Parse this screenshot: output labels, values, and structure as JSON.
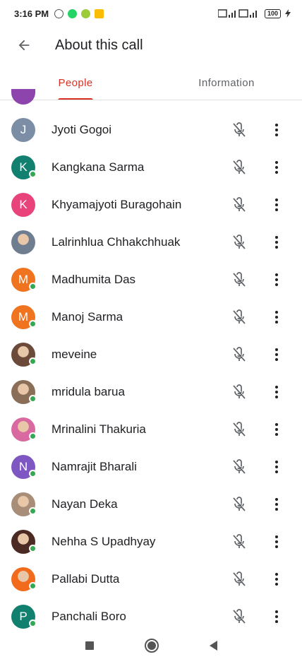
{
  "status_bar": {
    "time": "3:16 PM",
    "battery": "100"
  },
  "app_bar": {
    "title": "About this call"
  },
  "tabs": [
    {
      "label": "People",
      "active": true
    },
    {
      "label": "Information",
      "active": false
    }
  ],
  "colors": {
    "accent": "#d93025",
    "online": "#34a853",
    "peek_avatar": "#8e44ad"
  },
  "people": [
    {
      "name": "Jyoti Gogoi",
      "initial": "J",
      "avatar_color": "#7b8ea6",
      "photo": false,
      "online": false,
      "muted": true
    },
    {
      "name": "Kangkana Sarma",
      "initial": "K",
      "avatar_color": "#12806f",
      "photo": false,
      "online": true,
      "muted": true
    },
    {
      "name": "Khyamajyoti Buragohain",
      "initial": "K",
      "avatar_color": "#e8437a",
      "photo": false,
      "online": false,
      "muted": true
    },
    {
      "name": "Lalrinhlua Chhakchhuak",
      "initial": "",
      "avatar_color": "#6f7d90",
      "photo": true,
      "online": false,
      "muted": true
    },
    {
      "name": "Madhumita Das",
      "initial": "M",
      "avatar_color": "#f0731f",
      "photo": false,
      "online": true,
      "muted": true
    },
    {
      "name": "Manoj Sarma",
      "initial": "M",
      "avatar_color": "#f0731f",
      "photo": false,
      "online": true,
      "muted": true
    },
    {
      "name": "meveine",
      "initial": "",
      "avatar_color": "#6b4a3a",
      "photo": true,
      "online": true,
      "muted": true
    },
    {
      "name": "mridula barua",
      "initial": "",
      "avatar_color": "#8a6e58",
      "photo": true,
      "online": true,
      "muted": true
    },
    {
      "name": "Mrinalini Thakuria",
      "initial": "",
      "avatar_color": "#d96aa1",
      "photo": true,
      "online": true,
      "muted": true
    },
    {
      "name": "Namrajit Bharali",
      "initial": "N",
      "avatar_color": "#7e57c2",
      "photo": false,
      "online": true,
      "muted": true
    },
    {
      "name": "Nayan Deka",
      "initial": "",
      "avatar_color": "#a88d78",
      "photo": true,
      "online": true,
      "muted": true
    },
    {
      "name": "Nehha S Upadhyay",
      "initial": "",
      "avatar_color": "#4a2a22",
      "photo": true,
      "online": true,
      "muted": true
    },
    {
      "name": "Pallabi Dutta",
      "initial": "",
      "avatar_color": "#f26a1b",
      "photo": true,
      "online": true,
      "muted": true
    },
    {
      "name": "Panchali Boro",
      "initial": "P",
      "avatar_color": "#12806f",
      "photo": false,
      "online": true,
      "muted": true
    }
  ]
}
